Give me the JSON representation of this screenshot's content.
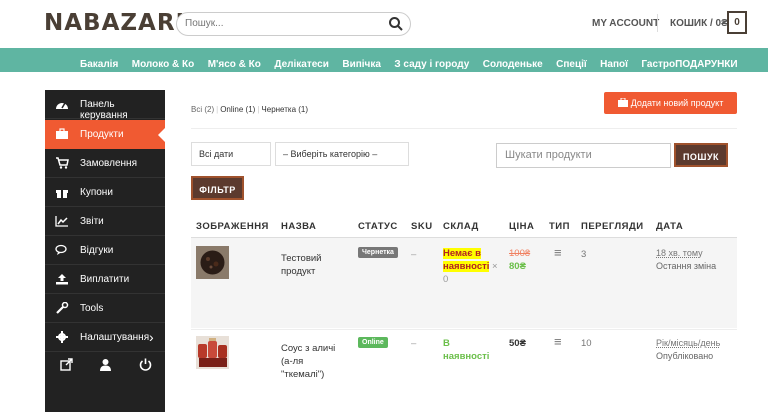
{
  "header": {
    "logo": "NABAZARI",
    "search_placeholder": "Пошук...",
    "my_account": "MY ACCOUNT",
    "cart_label": "КОШИК / 0₴",
    "cart_count": "0"
  },
  "nav": {
    "items": [
      "Бакалія",
      "Молоко & Ко",
      "М'ясо & Ко",
      "Делікатеси",
      "Випічка",
      "З саду і городу",
      "Солоденьке",
      "Спеції",
      "Напої",
      "ГастроПОДАРУНКИ"
    ]
  },
  "sidebar": {
    "items": [
      {
        "label": "Панель керування",
        "icon": "dashboard-icon"
      },
      {
        "label": "Продукти",
        "icon": "briefcase-icon"
      },
      {
        "label": "Замовлення",
        "icon": "cart-icon"
      },
      {
        "label": "Купони",
        "icon": "gift-icon"
      },
      {
        "label": "Звіти",
        "icon": "chart-icon"
      },
      {
        "label": "Відгуки",
        "icon": "comments-icon"
      },
      {
        "label": "Виплатити",
        "icon": "upload-icon"
      },
      {
        "label": "Tools",
        "icon": "wrench-icon"
      },
      {
        "label": "Налаштування",
        "icon": "gear-icon"
      }
    ],
    "settings_arrow": "›"
  },
  "filters": {
    "all": "Всі (2)",
    "online": "Online (1)",
    "draft": "Чернетка (1)",
    "sep": "|"
  },
  "add_button": "Додати новий продукт",
  "controls": {
    "dates": "Всі дати",
    "category": "– Виберіть категорію –",
    "search_placeholder": "Шукати продукти",
    "search_button": "ПОШУК",
    "filter_button": "ФІЛЬТР"
  },
  "table": {
    "headers": [
      "ЗОБРАЖЕННЯ",
      "НАЗВА",
      "СТАТУС",
      "SKU",
      "СКЛАД",
      "ЦІНА",
      "ТИП",
      "ПЕРЕГЛЯДИ",
      "ДАТА"
    ],
    "rows": [
      {
        "name_line1": "Тестовий",
        "name_line2": "продукт",
        "status": "Чернетка",
        "sku": "–",
        "stock_line1": "Немає в",
        "stock_line2": "наявності",
        "stock_extra": "×",
        "stock_count": "0",
        "price_old": "100₴",
        "price_new": "80₴",
        "type": "≡",
        "views": "3",
        "date": "18 хв. тому",
        "date_note": "Остання зміна"
      },
      {
        "name_line1": "Соус з аличі",
        "name_line2": "(а-ля",
        "name_line3": "\"ткемалі\")",
        "status": "Online",
        "sku": "–",
        "stock_line1": "В",
        "stock_line2": "наявності",
        "price": "50₴",
        "type": "≡",
        "views": "10",
        "date": "Рік/місяць/день",
        "date_note": "Опубліковано"
      }
    ]
  },
  "colors": {
    "accent": "#f05a32",
    "nav_bg": "#5fb5a2",
    "sidebar_bg": "#222222",
    "button_dark": "#5c3a2e"
  }
}
